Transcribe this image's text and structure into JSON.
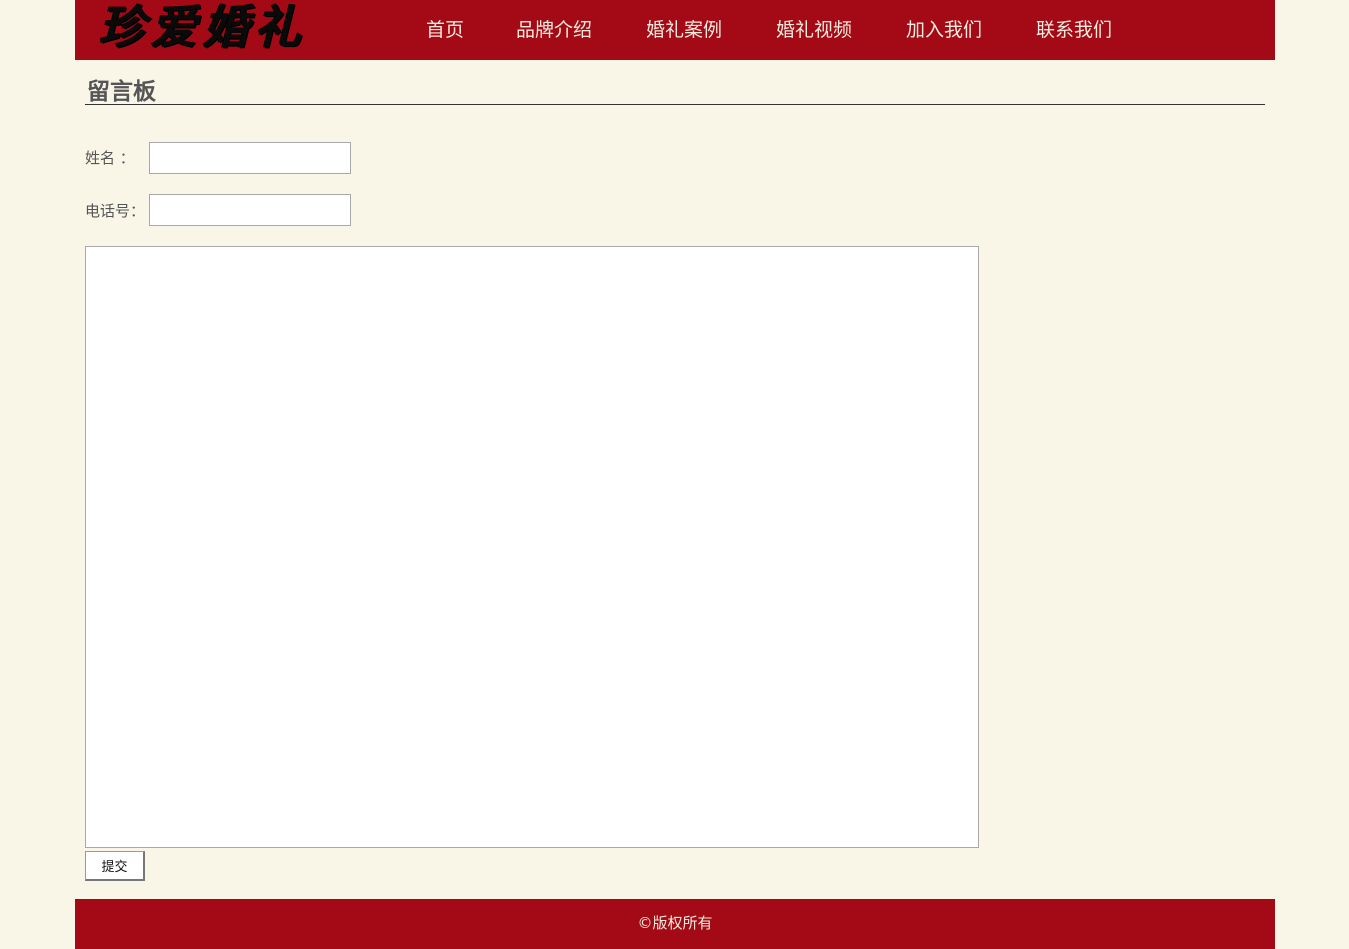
{
  "header": {
    "logo_text": "珍爱婚礼",
    "nav": [
      {
        "label": "首页"
      },
      {
        "label": "品牌介绍"
      },
      {
        "label": "婚礼案例"
      },
      {
        "label": "婚礼视频"
      },
      {
        "label": "加入我们"
      },
      {
        "label": "联系我们"
      }
    ]
  },
  "main": {
    "title": "留言板",
    "name_label": "姓名 ：",
    "name_value": "",
    "phone_label": "电话号：",
    "phone_value": "",
    "message_value": "",
    "submit_label": "提交"
  },
  "footer": {
    "copyright": "©版权所有"
  },
  "colors": {
    "brand_red": "#a30a15",
    "page_background": "#f9f6e8"
  }
}
